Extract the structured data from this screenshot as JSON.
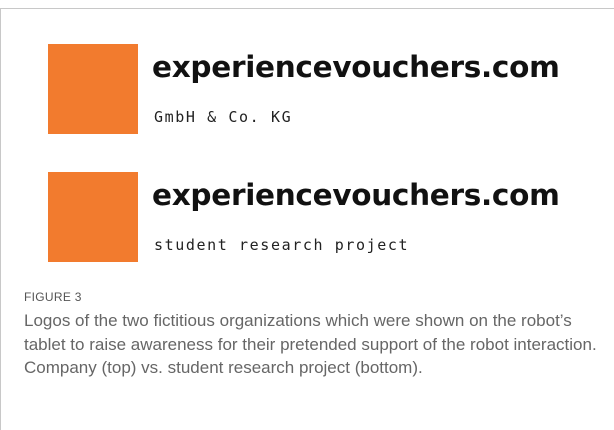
{
  "figure": {
    "label": "FIGURE 3",
    "caption": "Logos of the two fictitious organizations which were shown on the robot’s tablet to raise awareness for their pretended support of the robot interaction. Company (top) vs. student research project (bottom)."
  },
  "logos": [
    {
      "name": "experiencevouchers.com",
      "tagline": "GmbH & Co. KG",
      "square_color": "#f27b2e"
    },
    {
      "name": "experiencevouchers.com",
      "tagline": "student research project",
      "square_color": "#f27b2e"
    }
  ],
  "colors": {
    "accent": "#f27b2e",
    "frame": "#c8c8c8",
    "caption_text": "#666666"
  }
}
